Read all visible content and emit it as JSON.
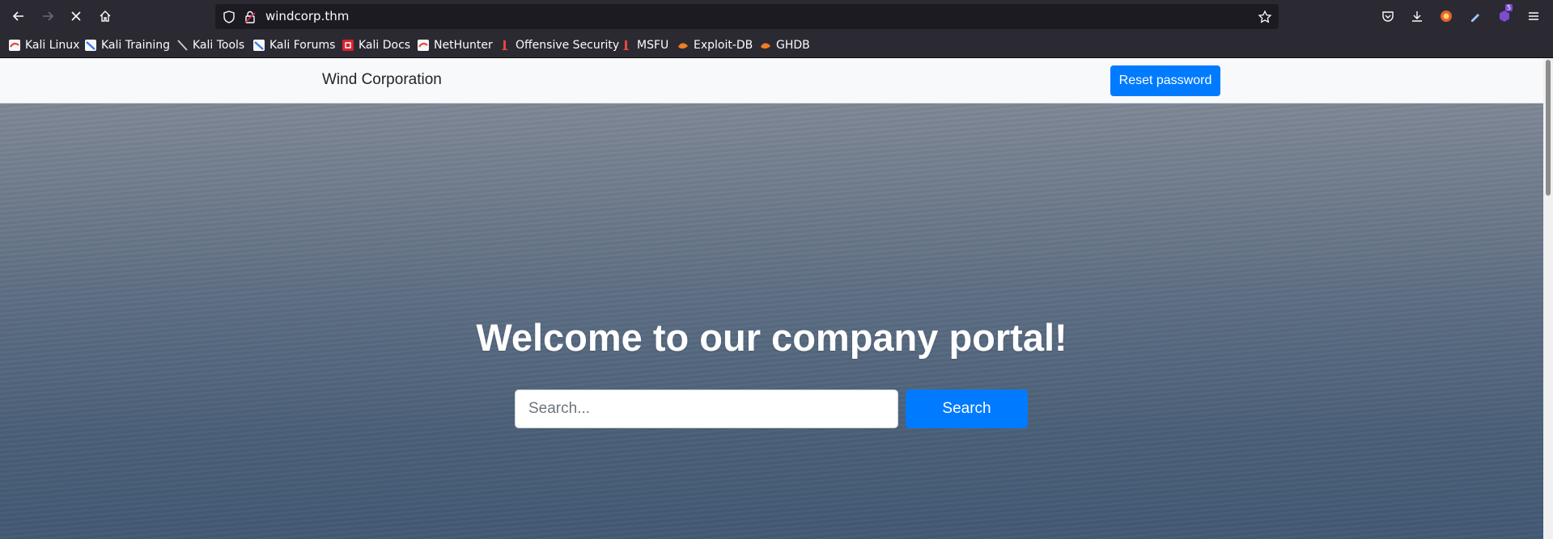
{
  "browser": {
    "url": "windcorp.thm",
    "extension_badge": "5",
    "bookmarks": [
      {
        "label": "Kali Linux",
        "icon": "kali-icon"
      },
      {
        "label": "Kali Training",
        "icon": "kali-training-icon"
      },
      {
        "label": "Kali Tools",
        "icon": "kali-tools-icon"
      },
      {
        "label": "Kali Forums",
        "icon": "kali-forums-icon"
      },
      {
        "label": "Kali Docs",
        "icon": "kali-docs-icon"
      },
      {
        "label": "NetHunter",
        "icon": "nethunter-icon"
      },
      {
        "label": "Offensive Security",
        "icon": "offsec-icon"
      },
      {
        "label": "MSFU",
        "icon": "msfu-icon"
      },
      {
        "label": "Exploit-DB",
        "icon": "exploitdb-icon"
      },
      {
        "label": "GHDB",
        "icon": "ghdb-icon"
      }
    ]
  },
  "navbar": {
    "brand": "Wind Corporation",
    "reset_label": "Reset password"
  },
  "hero": {
    "title": "Welcome to our company portal!",
    "search_placeholder": "Search...",
    "search_label": "Search"
  },
  "colors": {
    "primary": "#007bff",
    "navbar_bg": "#f8f9fa",
    "chrome_bg": "#2b2a33"
  }
}
